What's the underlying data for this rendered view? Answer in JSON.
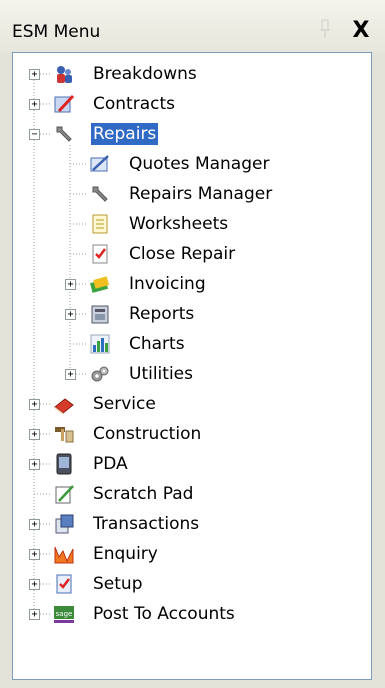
{
  "window": {
    "title": "ESM Menu",
    "close_label": "X"
  },
  "tree": {
    "breakdowns": "Breakdowns",
    "contracts": "Contracts",
    "repairs": "Repairs",
    "quotes_manager": "Quotes Manager",
    "repairs_manager": "Repairs Manager",
    "worksheets": "Worksheets",
    "close_repair": "Close Repair",
    "invoicing": "Invoicing",
    "reports": "Reports",
    "charts": "Charts",
    "utilities": "Utilities",
    "service": "Service",
    "construction": "Construction",
    "pda": "PDA",
    "scratch_pad": "Scratch Pad",
    "transactions": "Transactions",
    "enquiry": "Enquiry",
    "setup": "Setup",
    "post_to_accounts": "Post To Accounts",
    "expand_symbol": "+",
    "collapse_symbol": "−",
    "sage_logo_text": "sage"
  },
  "colors": {
    "selection": "#316ac5",
    "panel": "#e4e3da",
    "border": "#7f9db9"
  }
}
